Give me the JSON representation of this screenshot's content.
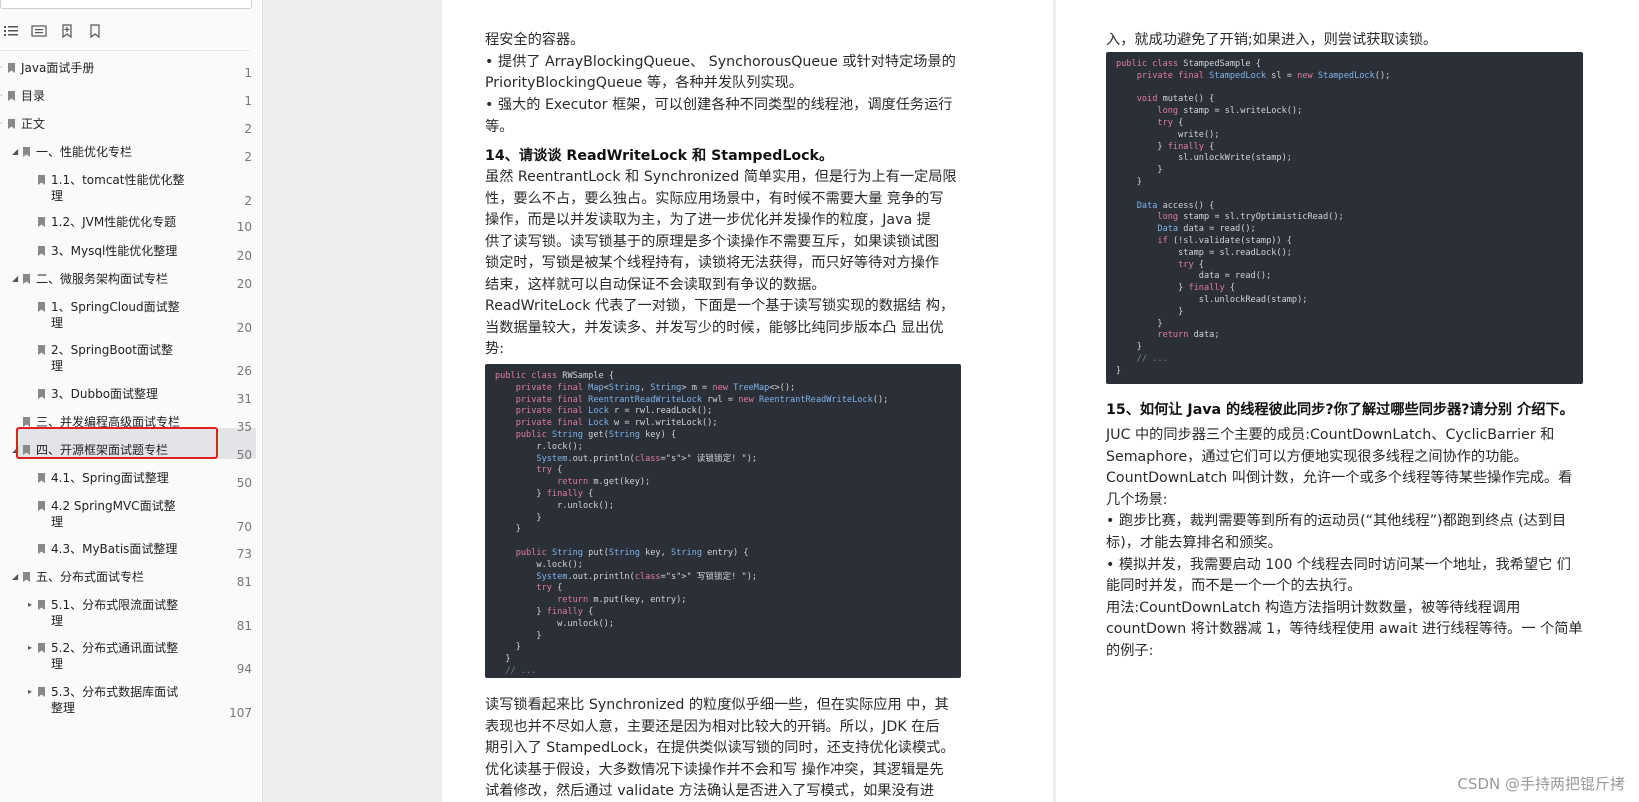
{
  "sidebar": {
    "toolbar": [
      {
        "icon": "expand-all-icon"
      },
      {
        "icon": "collapse-all-icon"
      },
      {
        "icon": "add-bookmark-icon"
      },
      {
        "icon": "bookmark-icon"
      }
    ],
    "items": [
      {
        "label": "Java面试手册",
        "page": "1",
        "level": 0,
        "arrow": ""
      },
      {
        "label": "目录",
        "page": "1",
        "level": 0,
        "arrow": ""
      },
      {
        "label": "正文",
        "page": "2",
        "level": 0,
        "arrow": ""
      },
      {
        "label": "一、性能优化专栏",
        "page": "2",
        "level": 1,
        "arrow": "▲"
      },
      {
        "label": "1.1、tomcat性能优化整",
        "label2": "理",
        "page": "2",
        "level": 2,
        "arrow": ""
      },
      {
        "label": "1.2、JVM性能优化专题",
        "page": "10",
        "level": 2,
        "arrow": ""
      },
      {
        "label": "3、Mysql性能优化整理",
        "page": "20",
        "level": 2,
        "arrow": ""
      },
      {
        "label": "二、微服务架构面试专栏",
        "page": "20",
        "level": 1,
        "arrow": "▲"
      },
      {
        "label": "1、SpringCloud面试整",
        "label2": "理",
        "page": "20",
        "level": 2,
        "arrow": ""
      },
      {
        "label": "2、SpringBoot面试整",
        "label2": "理",
        "page": "26",
        "level": 2,
        "arrow": ""
      },
      {
        "label": "3、Dubbo面试整理",
        "page": "31",
        "level": 2,
        "arrow": ""
      },
      {
        "label": "三、并发编程高级面试专栏",
        "page": "35",
        "level": 1,
        "arrow": ""
      },
      {
        "label": "四、开源框架面试题专栏",
        "page": "50",
        "level": 1,
        "arrow": "▲"
      },
      {
        "label": "4.1、Spring面试整理",
        "page": "50",
        "level": 2,
        "arrow": ""
      },
      {
        "label": "4.2 SpringMVC面试整",
        "label2": "理",
        "page": "70",
        "level": 2,
        "arrow": ""
      },
      {
        "label": "4.3、MyBatis面试整理",
        "page": "73",
        "level": 2,
        "arrow": ""
      },
      {
        "label": "五、分布式面试专栏",
        "page": "81",
        "level": 1,
        "arrow": "▲"
      },
      {
        "label": "5.1、分布式限流面试整",
        "label2": "理",
        "page": "81",
        "level": 2,
        "arrow": "▶"
      },
      {
        "label": "5.2、分布式通讯面试整",
        "label2": "理",
        "page": "94",
        "level": 2,
        "arrow": "▶"
      },
      {
        "label": "5.3、分布式数据库面试",
        "label2": "整理",
        "page": "107",
        "level": 2,
        "arrow": "▶"
      }
    ]
  },
  "left_page": {
    "lines": [
      {
        "text": "程安全的容器。",
        "heading": false
      },
      {
        "text": "• 提供了 ArrayBlockingQueue、 SynchorousQueue 或针对特定场景的",
        "heading": false
      },
      {
        "text": "PriorityBlockingQueue 等，各种并发队列实现。",
        "heading": false
      },
      {
        "text": "• 强大的 Executor 框架，可以创建各种不同类型的线程池，调度任务运行",
        "heading": false
      },
      {
        "text": "等。",
        "heading": false
      },
      {
        "text": "14、请谈谈 ReadWriteLock 和 StampedLock。",
        "heading": true
      },
      {
        "text": "虽然 ReentrantLock 和 Synchronized 简单实用，但是行为上有一定局限",
        "heading": false
      },
      {
        "text": "性，要么不占，要么独占。实际应用场景中，有时候不需要大量 竞争的写",
        "heading": false
      },
      {
        "text": "操作，而是以并发读取为主，为了进一步优化并发操作的粒度，Java 提",
        "heading": false
      },
      {
        "text": "供了读写锁。读写锁基于的原理是多个读操作不需要互斥，如果读锁试图",
        "heading": false
      },
      {
        "text": "锁定时，写锁是被某个线程持有，读锁将无法获得，而只好等待对方操作",
        "heading": false
      },
      {
        "text": "结束，这样就可以自动保证不会读取到有争议的数据。",
        "heading": false
      },
      {
        "text": "ReadWriteLock 代表了一对锁，下面是一个基于读写锁实现的数据结 构，",
        "heading": false
      },
      {
        "text": "当数据量较大，并发读多、并发写少的时候，能够比纯同步版本凸 显出优",
        "heading": false
      },
      {
        "text": "势:",
        "heading": false
      }
    ],
    "code": [
      "public class RWSample {",
      "    private final Map<String, String> m = new TreeMap<>();",
      "    private final ReentrantReadWriteLock rwl = new ReentrantReadWriteLock();",
      "    private final Lock r = rwl.readLock();",
      "    private final Lock w = rwl.writeLock();",
      "    public String get(String key) {",
      "        r.lock();",
      "        System.out.println(\" 读锁锁定! \");",
      "        try {",
      "            return m.get(key);",
      "        } finally {",
      "            r.unlock();",
      "        }",
      "    }",
      "",
      "    public String put(String key, String entry) {",
      "        w.lock();",
      "        System.out.println(\" 写锁锁定! \");",
      "        try {",
      "            return m.put(key, entry);",
      "        } finally {",
      "            w.unlock();",
      "        }",
      "    }",
      "  }",
      "  // ...",
      "}"
    ],
    "after": [
      "读写锁看起来比 Synchronized 的粒度似乎细一些，但在实际应用 中，其",
      "表现也并不尽如人意，主要还是因为相对比较大的开销。所以，JDK 在后",
      "期引入了 StampedLock，在提供类似读写锁的同时，还支持优化读模式。",
      "优化读基于假设，大多数情况下读操作并不会和写 操作冲突，其逻辑是先",
      "试着修改，然后通过 validate 方法确认是否进入了写模式，如果没有进"
    ]
  },
  "right_page": {
    "top_line": "入，就成功避免了开销;如果进入，则尝试获取读锁。",
    "code": [
      "public class StampedSample {",
      "    private final StampedLock sl = new StampedLock();",
      "",
      "    void mutate() {",
      "        long stamp = sl.writeLock();",
      "        try {",
      "            write();",
      "        } finally {",
      "            sl.unlockWrite(stamp);",
      "        }",
      "    }",
      "",
      "    Data access() {",
      "        long stamp = sl.tryOptimisticRead();",
      "        Data data = read();",
      "        if (!sl.validate(stamp)) {",
      "            stamp = sl.readLock();",
      "            try {",
      "                data = read();",
      "            } finally {",
      "                sl.unlockRead(stamp);",
      "            }",
      "        }",
      "        return data;",
      "    }",
      "    // ...",
      "}"
    ],
    "heading": "15、如何让 Java 的线程彼此同步?你了解过哪些同步器?请分别 介绍下。",
    "lines": [
      "JUC 中的同步器三个主要的成员:CountDownLatch、CyclicBarrier 和",
      "Semaphore，通过它们可以方便地实现很多线程之间协作的功能。",
      "CountDownLatch 叫倒计数，允许一个或多个线程等待某些操作完成。看",
      "几个场景:",
      "• 跑步比赛，裁判需要等到所有的运动员(“其他线程”)都跑到终点 (达到目",
      "标)，才能去算排名和颁奖。",
      "• 模拟并发，我需要启动 100 个线程去同时访问某一个地址，我希望它 们",
      "能同时并发，而不是一个一个的去执行。",
      "用法:CountDownLatch 构造方法指明计数数量，被等待线程调用",
      "countDown 将计数器减 1，等待线程使用 await 进行线程等待。一 个简单",
      "的例子:"
    ]
  },
  "watermark": "CSDN @手持两把锟斤拷"
}
